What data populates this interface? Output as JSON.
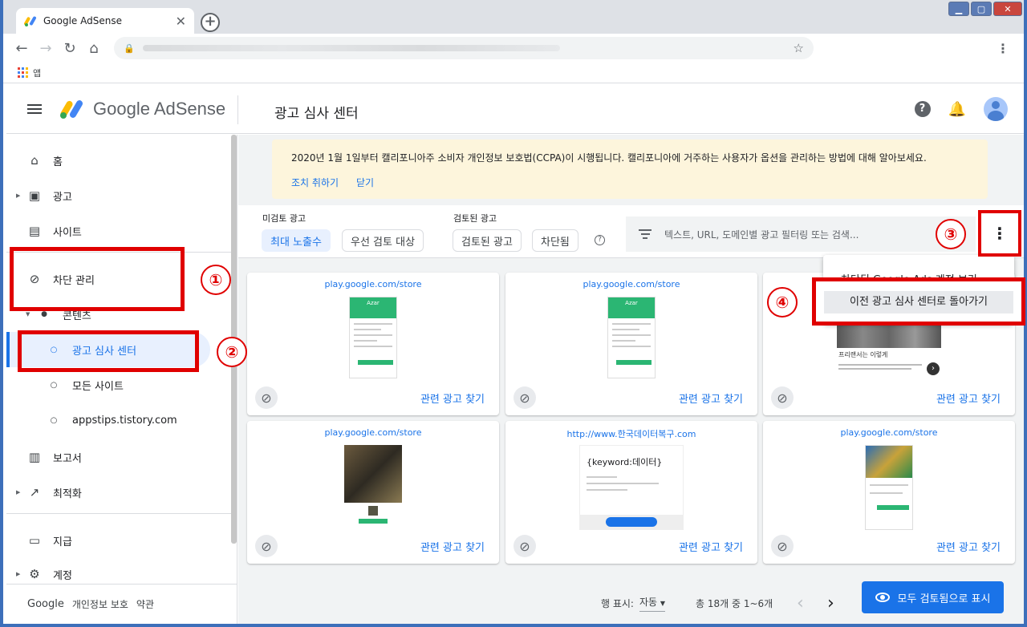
{
  "browser": {
    "tab_title": "Google AdSense",
    "tab_close": "✕",
    "new_tab": "+",
    "bookmark_apps": "앱",
    "window_controls": {
      "minimize": "▁",
      "maximize": "▢",
      "close": "✕"
    }
  },
  "header": {
    "logo_text": "Google AdSense",
    "page_title": "광고 심사 센터"
  },
  "sidebar": {
    "items": [
      {
        "label": "홈",
        "icon": "home-icon"
      },
      {
        "label": "광고",
        "icon": "ads-icon"
      },
      {
        "label": "사이트",
        "icon": "sites-icon"
      },
      {
        "label": "차단 관리",
        "icon": "block-icon"
      },
      {
        "label": "콘텐츠",
        "icon": "bullet-icon"
      },
      {
        "label": "광고 심사 센터",
        "icon": "circle-icon"
      },
      {
        "label": "모든 사이트",
        "icon": "circle-icon"
      },
      {
        "label": "appstips.tistory.com",
        "icon": "circle-icon"
      },
      {
        "label": "보고서",
        "icon": "reports-icon"
      },
      {
        "label": "최적화",
        "icon": "optimize-icon"
      },
      {
        "label": "지급",
        "icon": "payments-icon"
      },
      {
        "label": "계정",
        "icon": "settings-icon"
      }
    ],
    "footer": {
      "google": "Google",
      "privacy": "개인정보 보호",
      "terms": "약관"
    }
  },
  "banner": {
    "text": "2020년 1월 1일부터 캘리포니아주 소비자 개인정보 보호법(CCPA)이 시행됩니다. 캘리포니아에 거주하는 사용자가 옵션을 관리하는 방법에 대해 알아보세요.",
    "action_label": "조치 취하기",
    "dismiss_label": "닫기"
  },
  "filters": {
    "unreviewed_label": "미검토 광고",
    "unreviewed_chips": [
      "최대 노출수",
      "우선 검토 대상"
    ],
    "reviewed_label": "검토된 광고",
    "reviewed_chips": [
      "검토된 광고",
      "차단됨"
    ],
    "help": "?",
    "search_placeholder": "텍스트, URL, 도메인별 광고 필터링 또는 검색..."
  },
  "menu": {
    "more": "⋮",
    "items": [
      "차단된 Google Ads 계정 보기",
      "이전 광고 심사 센터로 돌아가기"
    ]
  },
  "cards": [
    {
      "url": "play.google.com/store",
      "find": "관련 광고 찾기",
      "thumb_label": "Azar"
    },
    {
      "url": "play.google.com/store",
      "find": "관련 광고 찾기",
      "thumb_label": "Azar"
    },
    {
      "url": "",
      "find": "관련 광고 찾기",
      "thumb_label": "프리랜서는 이렇게"
    },
    {
      "url": "play.google.com/store",
      "find": "관련 광고 찾기",
      "thumb_label": ""
    },
    {
      "url": "http://www.한국데이터복구.com",
      "find": "관련 광고 찾기",
      "thumb_label": "{keyword:데이터}"
    },
    {
      "url": "play.google.com/store",
      "find": "관련 광고 찾기",
      "thumb_label": ""
    }
  ],
  "pager": {
    "rows_label": "행 표시:",
    "rows_value": "자동",
    "range": "총 18개 중 1~6개",
    "prev": "‹",
    "next": "›"
  },
  "review_all_button": "모두 검토됨으로 표시",
  "annotations": [
    "①",
    "②",
    "③",
    "④"
  ],
  "colors": {
    "accent": "#1a73e8",
    "annotation": "#e00000",
    "banner_bg": "#fdf5dc"
  }
}
